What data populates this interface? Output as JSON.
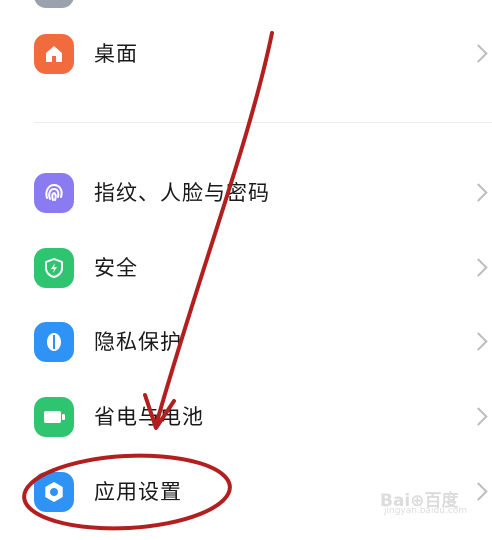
{
  "settings": {
    "items": [
      {
        "label": "桌面",
        "icon": "home-icon",
        "color": "#f26b3f"
      },
      {
        "label": "指纹、人脸与密码",
        "icon": "fingerprint-icon",
        "color": "#8a7cf0"
      },
      {
        "label": "安全",
        "icon": "shield-bolt-icon",
        "color": "#2fc46f"
      },
      {
        "label": "隐私保护",
        "icon": "privacy-shield-icon",
        "color": "#2f93f5"
      },
      {
        "label": "省电与电池",
        "icon": "battery-icon",
        "color": "#2fc46f"
      },
      {
        "label": "应用设置",
        "icon": "gear-icon",
        "color": "#2f93f5"
      }
    ]
  },
  "annotation": {
    "color": "#b11f1f",
    "highlighted_item": "应用设置"
  },
  "watermark": {
    "main": "Bai⊕百度",
    "sub": "jingyan.baidu.com"
  }
}
